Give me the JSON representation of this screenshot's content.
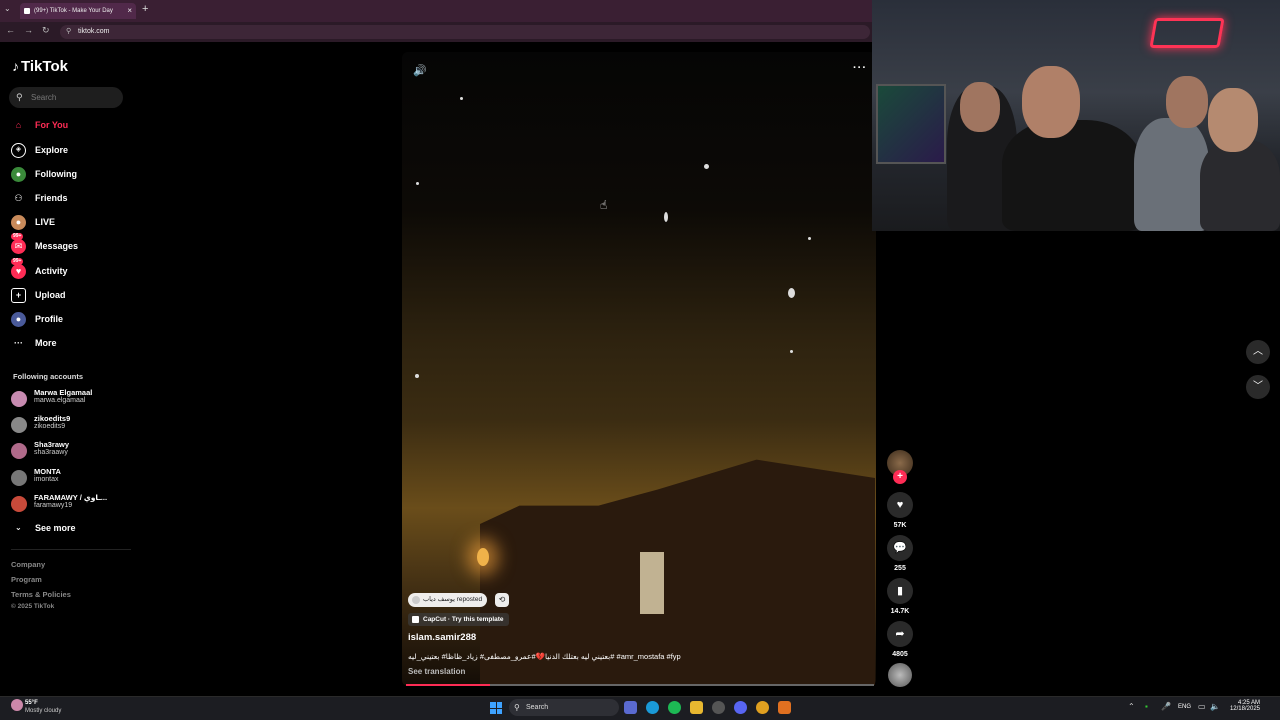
{
  "browser": {
    "tab_title": "(99+) TikTok - Make Your Day",
    "tab_close": "×",
    "new_tab": "+",
    "url": "tiktok.com"
  },
  "sidebar": {
    "logo": "TikTok",
    "search_placeholder": "Search",
    "nav": [
      {
        "label": "For You",
        "icon": "home-icon",
        "active": true
      },
      {
        "label": "Explore",
        "icon": "compass-icon"
      },
      {
        "label": "Following",
        "icon": "following-icon"
      },
      {
        "label": "Friends",
        "icon": "friends-icon"
      },
      {
        "label": "LIVE",
        "icon": "live-icon"
      },
      {
        "label": "Messages",
        "icon": "messages-icon",
        "badge": "99+"
      },
      {
        "label": "Activity",
        "icon": "activity-icon",
        "badge": "99+"
      },
      {
        "label": "Upload",
        "icon": "upload-icon"
      },
      {
        "label": "Profile",
        "icon": "profile-icon"
      },
      {
        "label": "More",
        "icon": "more-icon"
      }
    ],
    "following_title": "Following accounts",
    "accounts": [
      {
        "name": "Marwa Elgamaal",
        "handle": "marwa.elgamaal"
      },
      {
        "name": "zikoedits9",
        "handle": "zikoedits9"
      },
      {
        "name": "Sha3rawy",
        "handle": "sha3raawy"
      },
      {
        "name": "MONTA",
        "handle": "imontax"
      },
      {
        "name": "FARAMAWY / ـاوي...",
        "handle": "faramawy19"
      }
    ],
    "see_more": "See more",
    "footer": [
      "Company",
      "Program",
      "Terms & Policies",
      "© 2025 TikTok"
    ]
  },
  "video": {
    "repost_label": "يوسف دياب reposted",
    "capcut_label": "CapCut · Try this template",
    "author": "islam.samir288",
    "caption": "بعتيني ليه بعتلك الدنيا💔#عمرو_مصطفى# زياد_ظاظا# بعتيني_ليه# #amr_mostafa #fyp",
    "see_translation": "See translation",
    "progress": 0.18
  },
  "actions": {
    "likes": "57K",
    "comments": "255",
    "saves": "14.7K",
    "shares": "4805"
  },
  "taskbar": {
    "weather_temp": "55°F",
    "weather_desc": "Mostly cloudy",
    "search": "Search",
    "lang": "ENG",
    "time": "4:25 AM",
    "date": "12/18/2025"
  },
  "colors": {
    "accent": "#fe2c55",
    "background": "#000000"
  }
}
